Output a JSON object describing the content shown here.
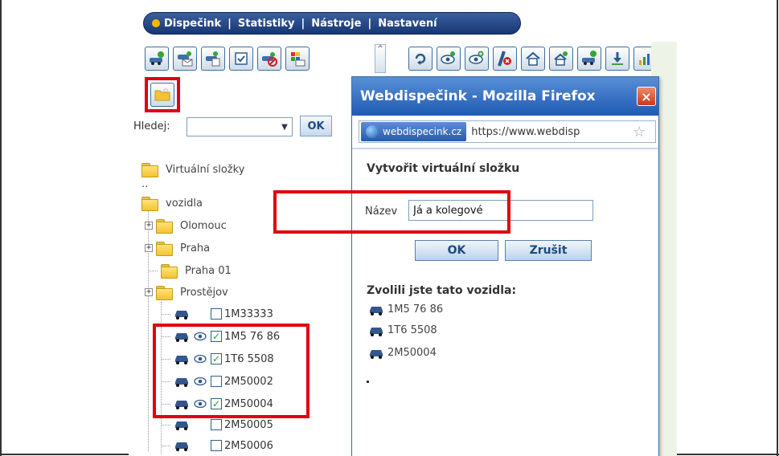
{
  "nav": {
    "items": [
      "Dispečink",
      "Statistiky",
      "Nástroje",
      "Nastavení"
    ],
    "separator": "|"
  },
  "toolbar_left": {
    "icons": [
      "vehicle-info-icon",
      "vehicle-message-icon",
      "vehicle-copy-icon",
      "checkbox-icon",
      "vehicle-remove-icon",
      "palette-message-icon"
    ],
    "new_folder_icon": "new-folder-icon"
  },
  "toolbar_right": {
    "icons": [
      "refresh-icon",
      "eye-icon",
      "eye-add-icon",
      "route-cancel-icon",
      "home-icon",
      "home-info-icon",
      "vehicle-add-icon",
      "download-icon",
      "chart-icon"
    ]
  },
  "search": {
    "label": "Hledej:",
    "value": "",
    "ok_label": "OK"
  },
  "tree": {
    "virtual_folders_label": "Virtuální složky",
    "parent_label": "..",
    "root_folder": "vozidla",
    "folders": [
      {
        "label": "Olomouc",
        "expandable": true
      },
      {
        "label": "Praha",
        "expandable": true
      },
      {
        "label": "Praha 01",
        "expandable": false
      },
      {
        "label": "Prostějov",
        "expandable": true
      }
    ],
    "vehicles": [
      {
        "label": "1M33333",
        "checked": false,
        "eye": false
      },
      {
        "label": "1M5 76 86",
        "checked": true,
        "eye": true
      },
      {
        "label": "1T6 5508",
        "checked": true,
        "eye": true
      },
      {
        "label": "2M50002",
        "checked": false,
        "eye": true
      },
      {
        "label": "2M50004",
        "checked": true,
        "eye": true
      },
      {
        "label": "2M50005",
        "checked": false,
        "eye": false
      },
      {
        "label": "2M50006",
        "checked": false,
        "eye": false
      }
    ]
  },
  "popup": {
    "title": "Webdispečink - Mozilla Firefox",
    "close_label": "×",
    "site_badge": "webdispecink.cz",
    "url": "https://www.webdisp",
    "heading": "Vytvořit virtuální složku",
    "name_label": "Název",
    "name_value": "Já a kolegové",
    "ok_label": "OK",
    "cancel_label": "Zrušit",
    "selected_heading": "Zvolili jste tato vozidla:",
    "selected_vehicles": [
      "1M5 76 86",
      "1T6 5508",
      "2M50004"
    ]
  },
  "colors": {
    "highlight": "#e00010",
    "nav_bg": "#1c3d7a",
    "accent_dot": "#f5b800",
    "titlebar": "#1e5ab4"
  }
}
